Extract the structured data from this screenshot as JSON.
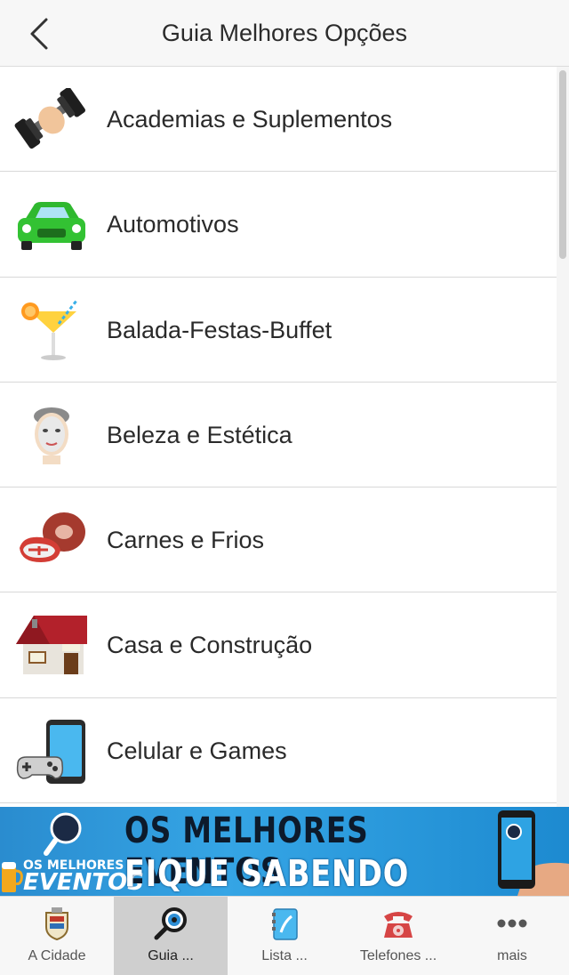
{
  "header": {
    "title": "Guia Melhores Opções",
    "back_icon": "chevron-left-icon"
  },
  "categories": [
    {
      "label": "Academias e Suplementos",
      "icon": "dumbbell-icon"
    },
    {
      "label": "Automotivos",
      "icon": "car-icon"
    },
    {
      "label": "Balada-Festas-Buffet",
      "icon": "cocktail-icon"
    },
    {
      "label": "Beleza e Estética",
      "icon": "face-mask-icon"
    },
    {
      "label": "Carnes e Frios",
      "icon": "meat-icon"
    },
    {
      "label": "Casa e Construção",
      "icon": "house-icon"
    },
    {
      "label": "Celular e Games",
      "icon": "phone-gamepad-icon"
    }
  ],
  "banner": {
    "line1": "OS MELHORES EVENTOS",
    "line2": "FIQUE SABENDO AQUI",
    "side_small": "OS MELHORES",
    "side_big": "EVENTOS"
  },
  "tabs": [
    {
      "label": "A Cidade",
      "icon": "city-crest-icon",
      "active": false
    },
    {
      "label": "Guia ...",
      "icon": "magnifier-icon",
      "active": true
    },
    {
      "label": "Lista ...",
      "icon": "contacts-book-icon",
      "active": false
    },
    {
      "label": "Telefones ...",
      "icon": "telephone-icon",
      "active": false
    },
    {
      "label": "mais",
      "icon": "more-dots-icon",
      "active": false
    }
  ],
  "colors": {
    "header_bg": "#f7f7f7",
    "active_tab_bg": "#cfcfcf",
    "banner_blue": "#35a5e5"
  }
}
